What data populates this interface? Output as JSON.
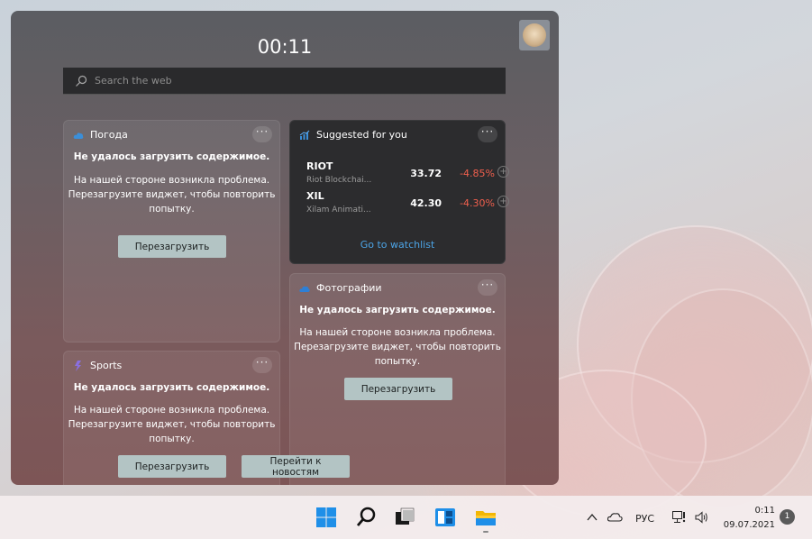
{
  "panel": {
    "time": "00:11",
    "search_placeholder": "Search the web"
  },
  "weather": {
    "title": "Погода",
    "error_title": "Не удалось загрузить содержимое.",
    "error_body_1": "На нашей стороне возникла проблема.",
    "error_body_2": "Перезагрузите виджет, чтобы повторить",
    "error_body_3": "попытку.",
    "reload_label": "Перезагрузить"
  },
  "suggested": {
    "title": "Suggested for you",
    "stocks": [
      {
        "symbol": "RIOT",
        "name": "Riot Blockchai...",
        "price": "33.72",
        "change": "-4.85%"
      },
      {
        "symbol": "XIL",
        "name": "Xilam Animati...",
        "price": "42.30",
        "change": "-4.30%"
      }
    ],
    "watchlist_label": "Go to watchlist"
  },
  "photos": {
    "title": "Фотографии",
    "error_title": "Не удалось загрузить содержимое.",
    "error_body_1": "На нашей стороне возникла проблема.",
    "error_body_2": "Перезагрузите виджет, чтобы повторить",
    "error_body_3": "попытку.",
    "reload_label": "Перезагрузить"
  },
  "sports": {
    "title": "Sports",
    "error_title": "Не удалось загрузить содержимое.",
    "error_body_1": "На нашей стороне возникла проблема.",
    "error_body_2": "Перезагрузите виджет, чтобы повторить",
    "error_body_3": "попытку.",
    "reload_label": "Перезагрузить",
    "news_label_1": "Перейти к",
    "news_label_2": "новостям"
  },
  "taskbar": {
    "icons": [
      "windows-start-icon",
      "search-icon",
      "task-view-icon",
      "widgets-icon",
      "file-explorer-icon"
    ],
    "language": "РУС",
    "time": "0:11",
    "date": "09.07.2021",
    "notification_count": "1"
  },
  "colors": {
    "accent_link": "#4ca4e6",
    "negative_change": "#f05f4d",
    "button_bg": "#b3c4c4"
  }
}
